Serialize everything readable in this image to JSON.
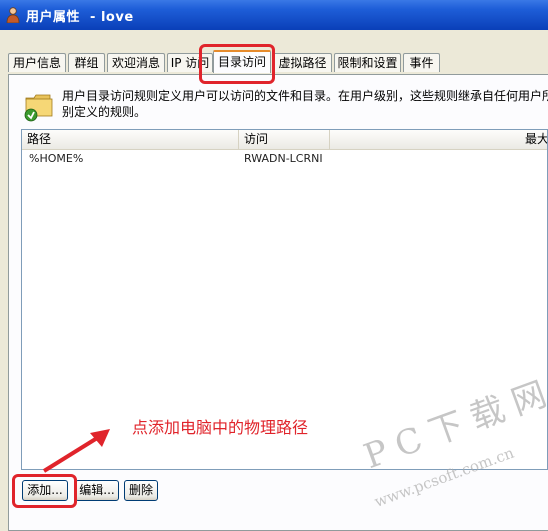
{
  "window": {
    "title": "用户属性  - love"
  },
  "tabs": [
    {
      "label": "用户信息"
    },
    {
      "label": "群组"
    },
    {
      "label": "欢迎消息"
    },
    {
      "label": "IP 访问"
    },
    {
      "label": "目录访问",
      "active": true
    },
    {
      "label": "虚拟路径"
    },
    {
      "label": "限制和设置"
    },
    {
      "label": "事件"
    }
  ],
  "description": {
    "line1": "用户目录访问规则定义用户可以访问的文件和目录。在用户级别，这些规则继承自任何用户所",
    "line2": "别定义的规则。"
  },
  "list": {
    "columns": [
      {
        "label": "路径"
      },
      {
        "label": "访问"
      },
      {
        "label": "最大"
      }
    ],
    "rows": [
      {
        "path": "%HOME%",
        "access": "RWADN-LCRNI"
      }
    ]
  },
  "buttons": {
    "add": "添加...",
    "edit": "编辑...",
    "delete": "删除"
  },
  "annotation": {
    "text": "点添加电脑中的物理路径",
    "color": "#e0242b"
  },
  "watermark": {
    "logo": "PC下载网",
    "url": "www.pcsoft.com.cn"
  },
  "colors": {
    "titlebar": "#0a3fb8",
    "active_tab_accent": "#e68b2c",
    "annotation": "#e0242b"
  }
}
